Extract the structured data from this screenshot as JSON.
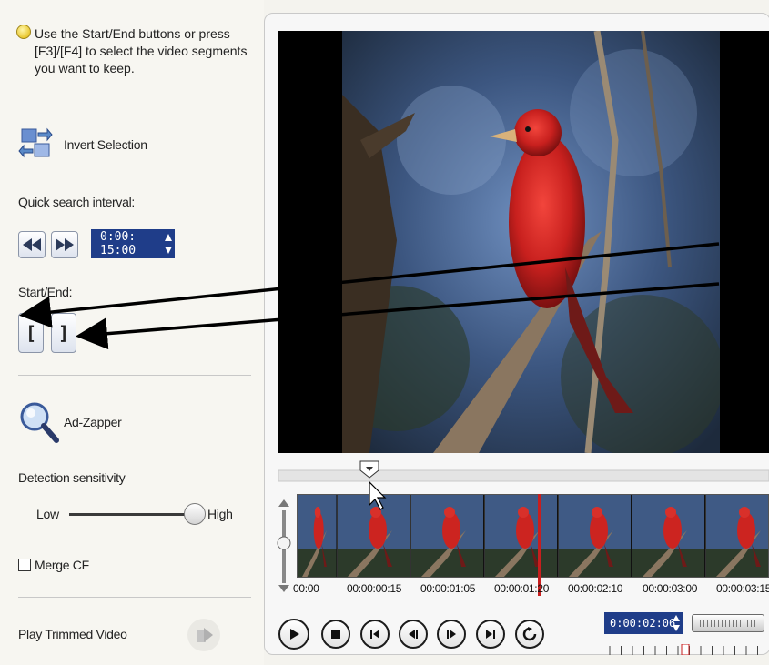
{
  "left": {
    "hint_line1": "Use the Start/End buttons or press",
    "hint_line2": "[F3]/[F4] to select the video segments",
    "hint_line3": "you want to keep.",
    "invert_selection_label": "Invert Selection",
    "quick_search_label": "Quick search interval:",
    "quick_search_value": "0:00: 15:00",
    "start_end_label": "Start/End:",
    "start_button_glyph": "[",
    "end_button_glyph": "]",
    "ad_zapper_label": "Ad-Zapper",
    "detection_label": "Detection sensitivity",
    "low_label": "Low",
    "high_label": "High",
    "merge_cf_label": "Merge CF",
    "play_trimmed_label": "Play Trimmed Video"
  },
  "sensitivity_level": 1.0,
  "timeline": {
    "timecodes": [
      "00:00",
      "00:00:00:15",
      "00:00:01:05",
      "00:00:01:20",
      "00:00:02:10",
      "00:00:03:00",
      "00:00:03:15"
    ]
  },
  "player": {
    "current_timecode": "0:00:02:06"
  },
  "icons": [
    "lightbulb-icon",
    "invert-selection-icon",
    "rewind-icon",
    "fast-forward-icon",
    "magnifier-icon",
    "play-trimmed-icon",
    "play-icon",
    "stop-icon",
    "go-start-icon",
    "step-back-icon",
    "step-forward-icon",
    "go-end-icon",
    "repeat-icon"
  ],
  "colors": {
    "timecode_bg": "#1f3d89",
    "playhead": "#c81e1e"
  }
}
